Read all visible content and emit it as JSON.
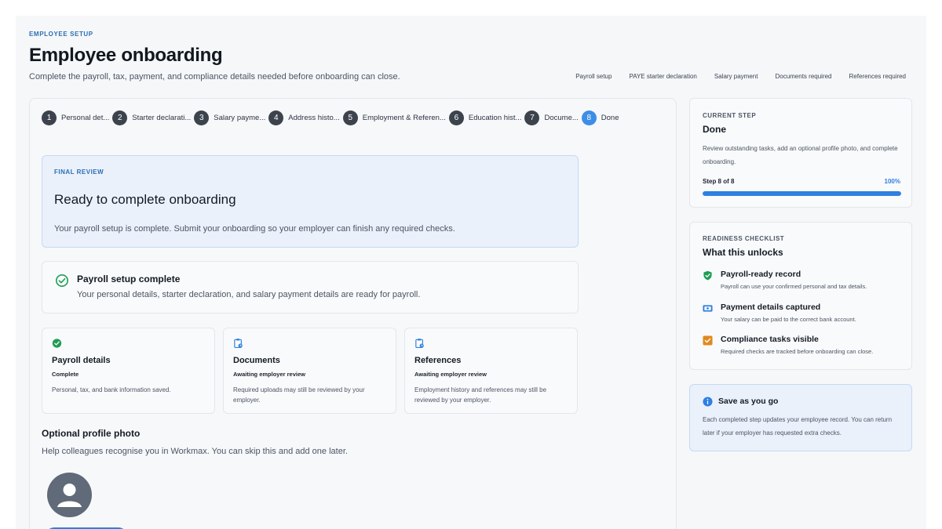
{
  "header": {
    "eyebrow": "EMPLOYEE SETUP",
    "title": "Employee onboarding",
    "subtitle": "Complete the payroll, tax, payment, and compliance details needed before onboarding can close.",
    "links": [
      "Payroll setup",
      "PAYE starter declaration",
      "Salary payment",
      "Documents required",
      "References required"
    ]
  },
  "stepper": {
    "steps": [
      {
        "num": "1",
        "label": "Personal det..."
      },
      {
        "num": "2",
        "label": "Starter declarati..."
      },
      {
        "num": "3",
        "label": "Salary payme..."
      },
      {
        "num": "4",
        "label": "Address histo..."
      },
      {
        "num": "5",
        "label": "Employment & Referen..."
      },
      {
        "num": "6",
        "label": "Education hist..."
      },
      {
        "num": "7",
        "label": "Docume..."
      },
      {
        "num": "8",
        "label": "Done"
      }
    ],
    "active_index": 7
  },
  "final_review": {
    "eyebrow": "FINAL REVIEW",
    "title": "Ready to complete onboarding",
    "text": "Your payroll setup is complete. Submit your onboarding so your employer can finish any required checks."
  },
  "payroll_complete": {
    "icon": "check-circle-icon",
    "title": "Payroll setup complete",
    "text": "Your personal details, starter declaration, and salary payment details are ready for payroll."
  },
  "status_cards": [
    {
      "icon": "check-circle-icon",
      "title": "Payroll details",
      "status": "Complete",
      "text": "Personal, tax, and bank information saved."
    },
    {
      "icon": "clipboard-clock-icon",
      "title": "Documents",
      "status": "Awaiting employer review",
      "text": "Required uploads may still be reviewed by your employer."
    },
    {
      "icon": "clipboard-clock-icon",
      "title": "References",
      "status": "Awaiting employer review",
      "text": "Employment history and references may still be reviewed by your employer."
    }
  ],
  "profile_photo": {
    "title": "Optional profile photo",
    "text": "Help colleagues recognise you in Workmax. You can skip this and add one later."
  },
  "current_step": {
    "eyebrow": "CURRENT STEP",
    "title": "Done",
    "text": "Review outstanding tasks, add an optional profile photo, and complete onboarding.",
    "progress_label": "Step 8 of 8",
    "progress_pct": "100%",
    "progress_value": 1.0
  },
  "checklist": {
    "eyebrow": "READINESS CHECKLIST",
    "title": "What this unlocks",
    "items": [
      {
        "icon": "shield-check-icon",
        "title": "Payroll-ready record",
        "text": "Payroll can use your confirmed personal and tax details."
      },
      {
        "icon": "payment-card-icon",
        "title": "Payment details captured",
        "text": "Your salary can be paid to the correct bank account."
      },
      {
        "icon": "checkbox-icon",
        "title": "Compliance tasks visible",
        "text": "Required checks are tracked before onboarding can close."
      }
    ]
  },
  "save_note": {
    "icon": "info-icon",
    "title": "Save as you go",
    "text": "Each completed step updates your employee record. You can return later if your employer has requested extra checks."
  },
  "colors": {
    "accent": "#2f80e0",
    "success": "#1f9d55",
    "warning": "#e08a1e"
  }
}
